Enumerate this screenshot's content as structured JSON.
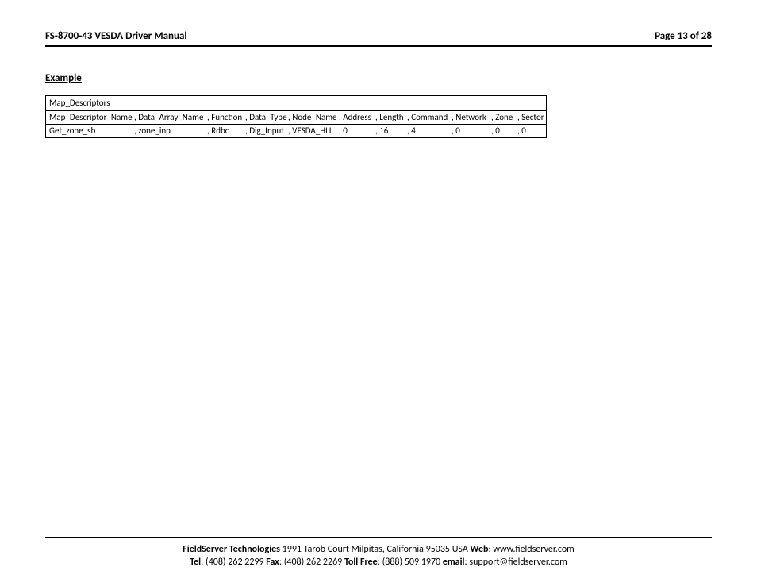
{
  "header": {
    "doc_title": "FS-8700-43 VESDA Driver Manual",
    "page_label": "Page 13 of 28"
  },
  "section": {
    "heading": "Example"
  },
  "table": {
    "title": "Map_Descriptors",
    "headers": [
      "Map_Descriptor_Name",
      ", Data_Array_Name",
      ", Function",
      ", Data_Type",
      ", Node_Name",
      ", Address",
      ", Length",
      ", Command",
      ", Network",
      ", Zone",
      ", Sector"
    ],
    "row": [
      "Get_zone_sb",
      ", zone_inp",
      ", Rdbc",
      ", Dig_Input",
      ", VESDA_HLI",
      ", 0",
      ", 16",
      ", 4",
      ", 0",
      ", 0",
      ", 0"
    ]
  },
  "footer": {
    "company": "FieldServer Technologies",
    "address": " 1991 Tarob Court Milpitas, California 95035 USA   ",
    "web_lbl": "Web",
    "web_val": ": www.fieldserver.com",
    "tel_lbl": "Tel",
    "tel_val": ": (408) 262 2299   ",
    "fax_lbl": "Fax",
    "fax_val": ": (408) 262 2269   ",
    "toll_lbl": "Toll Free",
    "toll_val": ": (888) 509 1970   ",
    "email_lbl": "email",
    "email_val": ": support@fieldserver.com"
  }
}
